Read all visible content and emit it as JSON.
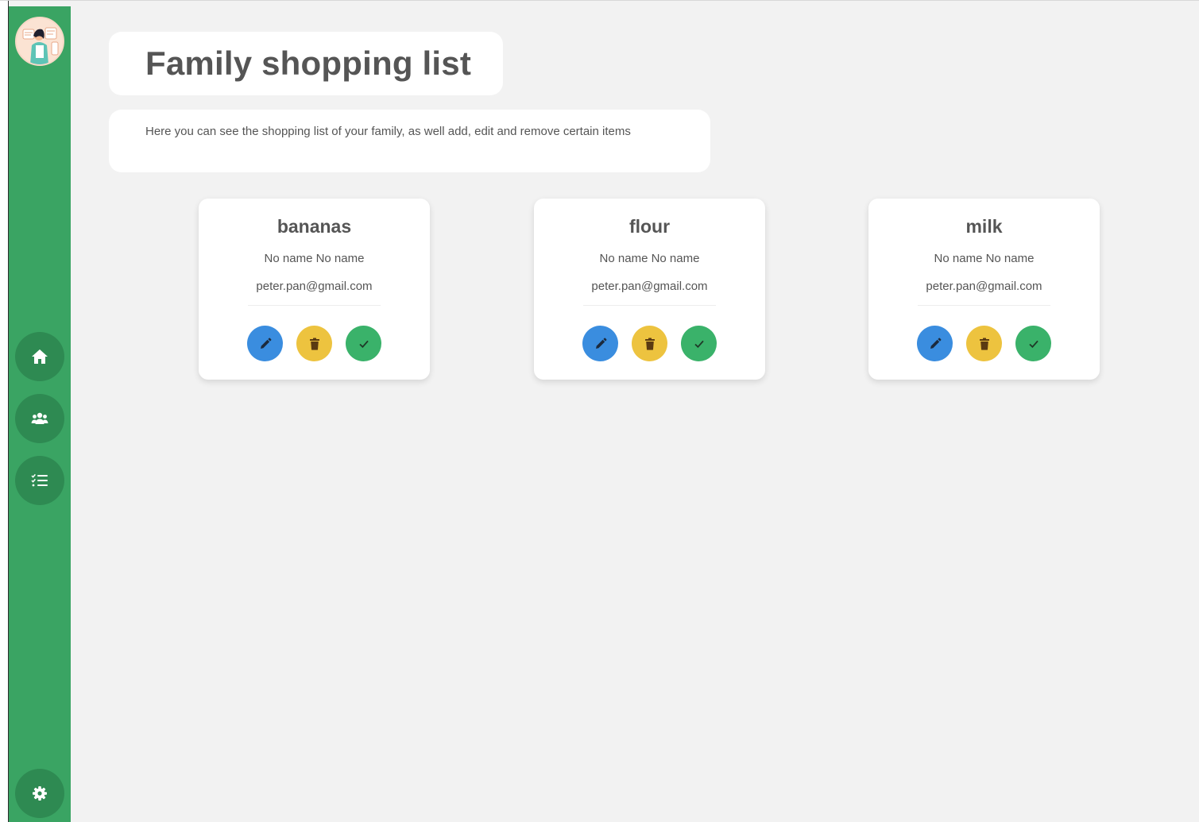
{
  "header": {
    "title": "Family shopping list",
    "description": "Here you can see the shopping list of your family, as well add, edit and remove certain items"
  },
  "sidebar": {
    "avatar_icon": "family-avatar-icon",
    "items": [
      {
        "name": "home",
        "icon": "home-icon"
      },
      {
        "name": "family",
        "icon": "users-icon"
      },
      {
        "name": "shopping-list",
        "icon": "checklist-icon"
      }
    ],
    "settings_icon": "gear-icon"
  },
  "items": [
    {
      "name": "bananas",
      "owner": "No name No name",
      "email": "peter.pan@gmail.com"
    },
    {
      "name": "flour",
      "owner": "No name No name",
      "email": "peter.pan@gmail.com"
    },
    {
      "name": "milk",
      "owner": "No name No name",
      "email": "peter.pan@gmail.com"
    }
  ],
  "actions": {
    "edit_icon": "pencil-icon",
    "delete_icon": "trash-icon",
    "done_icon": "check-icon"
  },
  "colors": {
    "sidebar": "#3aa463",
    "sidebar_button": "#2e8a52",
    "background": "#f2f2f2",
    "edit": "#3a8ddf",
    "delete": "#edc33f",
    "done": "#3ab26a",
    "text": "#555555"
  }
}
